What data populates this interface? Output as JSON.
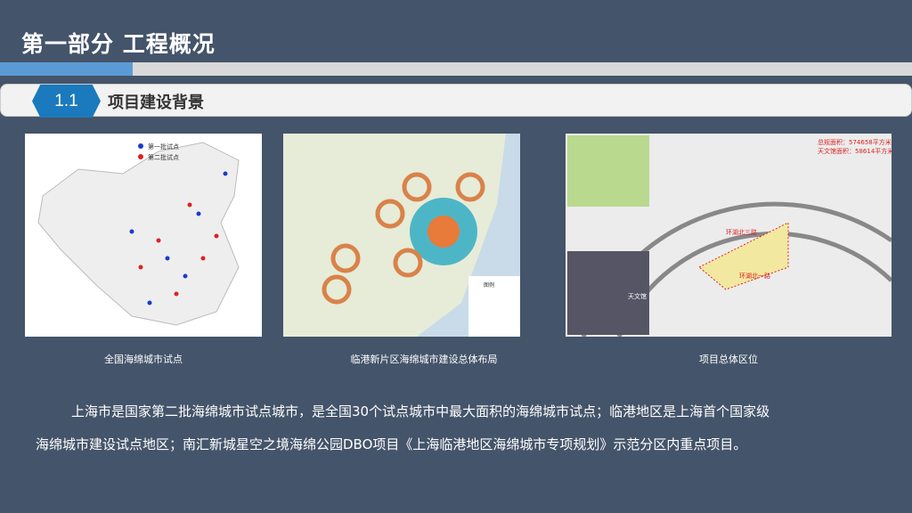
{
  "header": {
    "title": "第一部分  工程概况"
  },
  "section": {
    "number": "1.1",
    "title": "项目建设背景"
  },
  "figures": [
    {
      "caption": "全国海绵城市试点",
      "legend": [
        "第一批试点",
        "第二批试点"
      ]
    },
    {
      "caption": "临港新片区海绵城市建设总体布局",
      "legend_title": "图例"
    },
    {
      "caption": "项目总体区位",
      "labels": [
        "总规面积：574658平方米",
        "天文馆面积：58614平方米",
        "环湖北三路",
        "环湖北一路",
        "天文馆"
      ]
    }
  ],
  "paragraph": {
    "line1": "上海市是国家第二批海绵城市试点城市，是全国30个试点城市中最大面积的海绵城市试点；临港地区是上海首个国家级",
    "line2": "海绵城市建设试点地区；南汇新城星空之境海绵公园DBO项目《上海临港地区海绵城市专项规划》示范分区内重点项目。"
  }
}
